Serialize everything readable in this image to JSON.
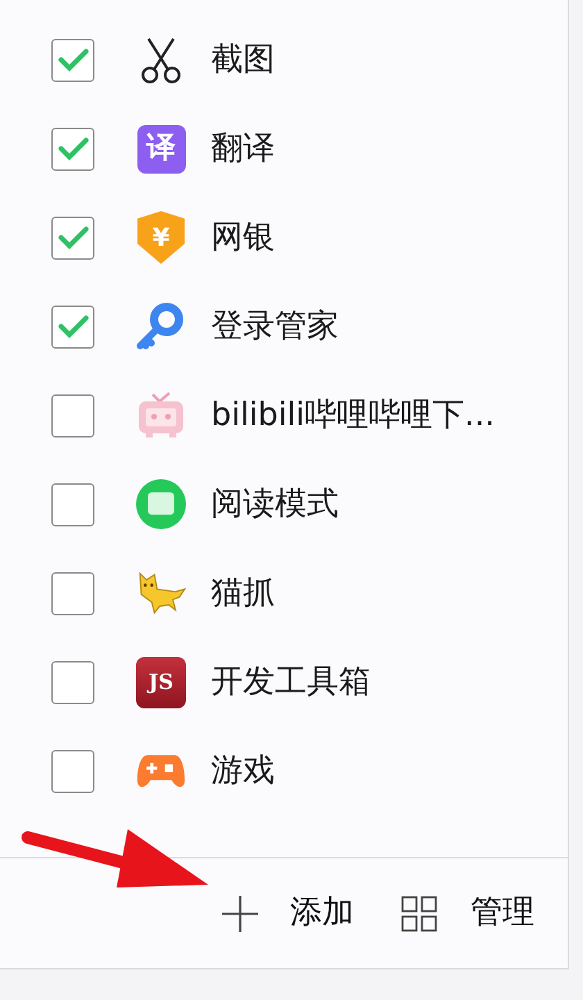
{
  "items": [
    {
      "label": "截图",
      "checked": true,
      "kind": "scissors"
    },
    {
      "label": "翻译",
      "checked": true,
      "kind": "translate",
      "glyph": "译"
    },
    {
      "label": "网银",
      "checked": true,
      "kind": "bank",
      "glyph": "¥"
    },
    {
      "label": "登录管家",
      "checked": true,
      "kind": "key"
    },
    {
      "label": "bilibili哔哩哔哩下...",
      "checked": false,
      "kind": "tv"
    },
    {
      "label": "阅读模式",
      "checked": false,
      "kind": "reader"
    },
    {
      "label": "猫抓",
      "checked": false,
      "kind": "cat"
    },
    {
      "label": "开发工具箱",
      "checked": false,
      "kind": "js",
      "glyph": "JS"
    },
    {
      "label": "游戏",
      "checked": false,
      "kind": "gamepad"
    }
  ],
  "footer": {
    "add_label": "添加",
    "manage_label": "管理"
  },
  "annotation_arrow": true
}
